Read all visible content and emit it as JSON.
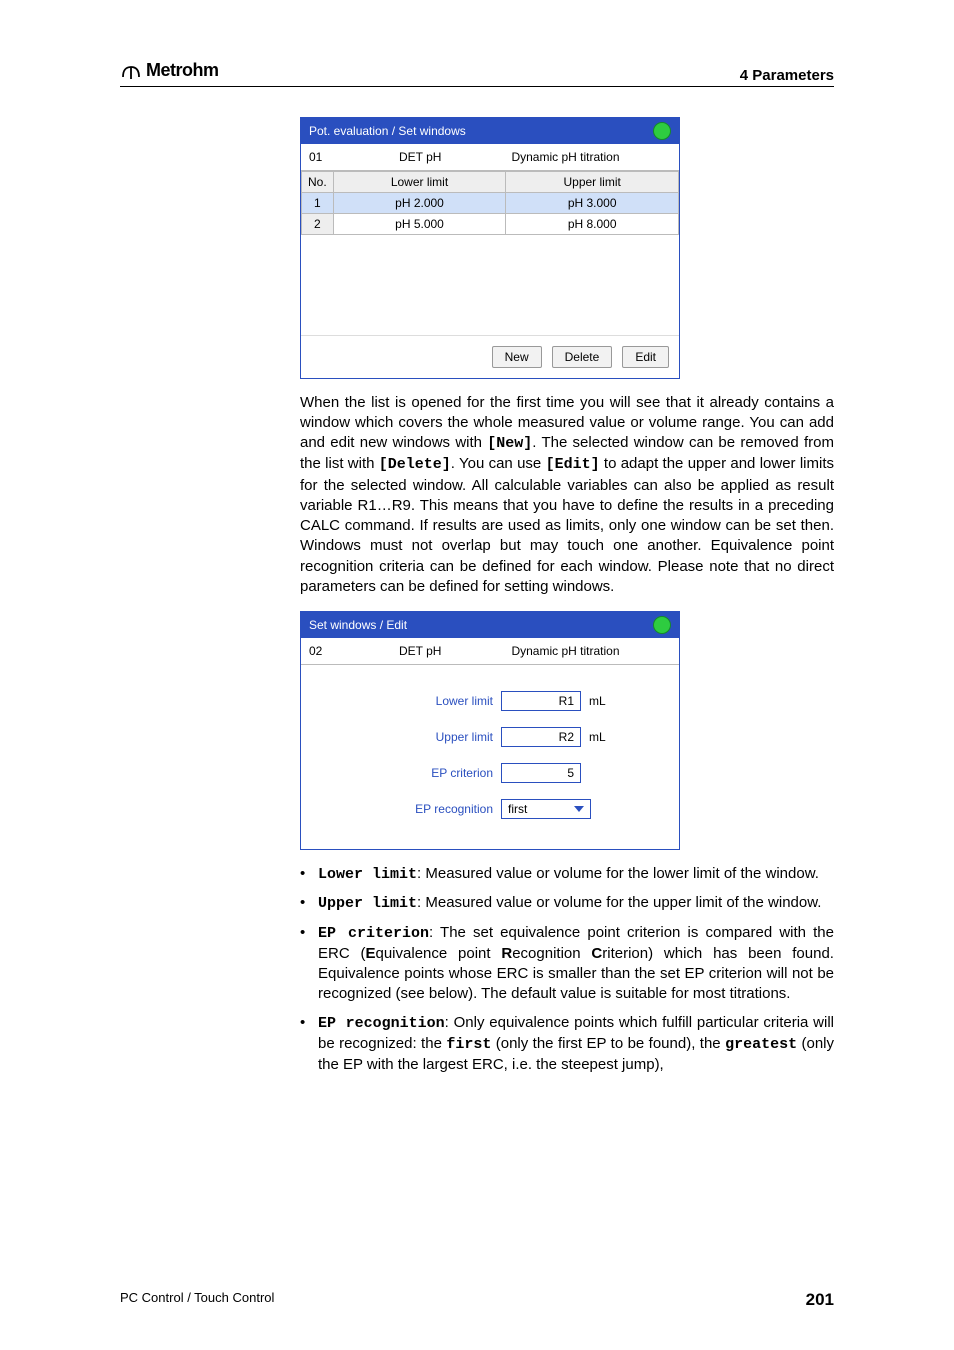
{
  "header": {
    "brand": "Metrohm",
    "section": "4 Parameters"
  },
  "dialog1": {
    "title": "Pot. evaluation / Set windows",
    "sub_num": "01",
    "sub_mode": "DET pH",
    "sub_desc": "Dynamic pH titration",
    "columns": {
      "no": "No.",
      "lower": "Lower limit",
      "upper": "Upper limit"
    },
    "rows": [
      {
        "no": "1",
        "lower": "pH 2.000",
        "upper": "pH 3.000"
      },
      {
        "no": "2",
        "lower": "pH 5.000",
        "upper": "pH 8.000"
      }
    ],
    "buttons": {
      "new": "New",
      "delete": "Delete",
      "edit": "Edit"
    }
  },
  "para1": {
    "t1": "When the list is opened for the first time you will see that it already contains a window which covers the whole measured value or volume range. You can add and edit new windows with ",
    "new": "[New]",
    "t2": ". The selected window can be removed from the list with ",
    "delete": "[Delete]",
    "t3": ". You can use ",
    "edit": "[Edit]",
    "t4": " to adapt the upper and lower limits for the selected window. All calculable variables can also be applied as result variable R1…R9. This means that you have to define the results in a preceding CALC command. If results are used as limits, only one window can be set then. Windows must not overlap but may touch one another. Equivalence point recognition criteria can be defined for each window. Please note that no direct parameters can be defined for setting windows."
  },
  "dialog2": {
    "title": "Set windows / Edit",
    "sub_num": "02",
    "sub_mode": "DET pH",
    "sub_desc": "Dynamic pH titration",
    "rows": {
      "lower": {
        "label": "Lower limit",
        "value": "R1",
        "unit": "mL"
      },
      "upper": {
        "label": "Upper limit",
        "value": "R2",
        "unit": "mL"
      },
      "epc": {
        "label": "EP criterion",
        "value": "5"
      },
      "epr": {
        "label": "EP recognition",
        "value": "first"
      }
    }
  },
  "bullets": {
    "b1": {
      "term": "Lower limit",
      "text": ": Measured value or volume for the lower limit of the window."
    },
    "b2": {
      "term": "Upper limit",
      "text": ": Measured value or volume for the upper limit of the window."
    },
    "b3": {
      "term": "EP criterion",
      "p1": ": The set equivalence point criterion is compared with the ERC (",
      "e": "E",
      "e1": "quivalence point ",
      "r": "R",
      "r1": "ecognition ",
      "c": "C",
      "c1": "riterion) which has been found. Equivalence points whose ERC is smaller than the set EP criterion will not be recognized (see below). The default value is suitable for most titrations."
    },
    "b4": {
      "term": "EP recognition",
      "p1": ": Only equivalence points which fulfill particular criteria will be recognized: the ",
      "first": "first",
      "p2": " (only the first EP to be found), the ",
      "greatest": "greatest",
      "p3": " (only the EP with the largest ERC, i.e. the steepest jump),"
    }
  },
  "footer": {
    "left": "PC Control / Touch Control",
    "page": "201"
  }
}
